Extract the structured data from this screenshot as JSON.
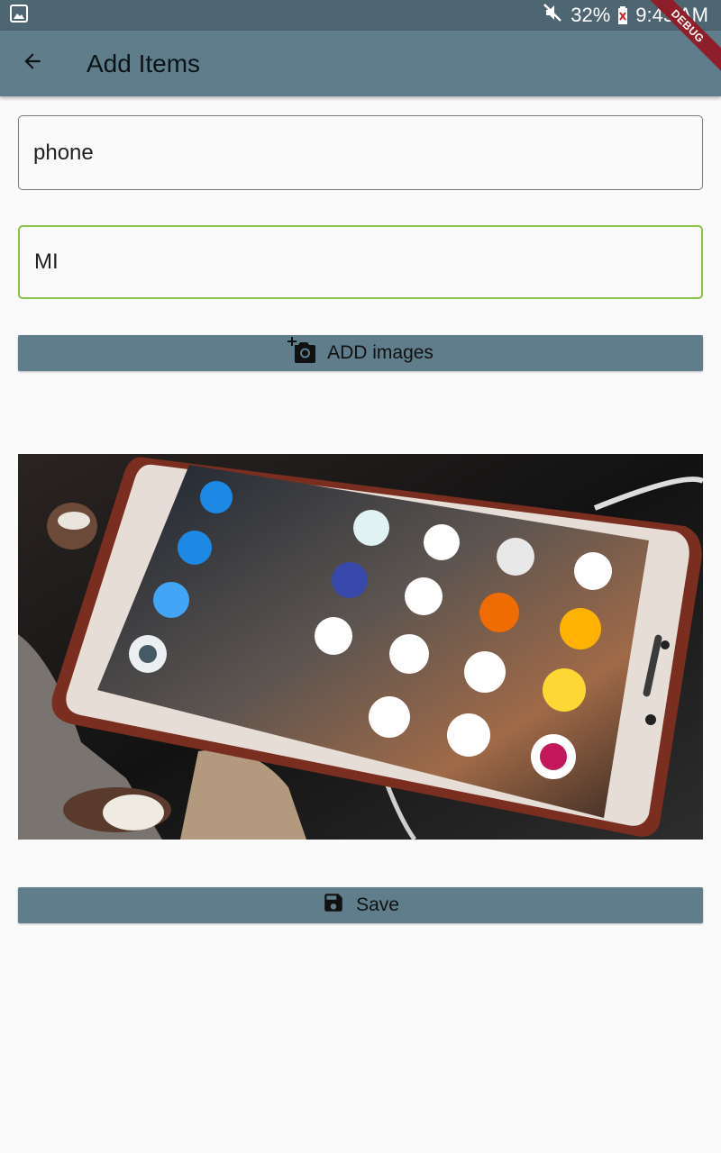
{
  "status_bar": {
    "battery": "32%",
    "time": "9:45 AM",
    "icons": [
      "gallery-icon",
      "mute-icon",
      "battery-icon"
    ]
  },
  "app_bar": {
    "title": "Add Items",
    "back_icon": "arrow-back-icon"
  },
  "debug_banner": "DEBUG",
  "form": {
    "name_value": "phone",
    "brand_value": "MI",
    "add_images_label": "ADD images",
    "add_images_icon": "add-a-photo-icon",
    "save_label": "Save",
    "save_icon": "save-icon"
  },
  "colors": {
    "app_bar": "#607d8b",
    "status_bar": "#4e6572",
    "focused_border": "#8bc34a",
    "debug_banner": "#8e1f2a"
  }
}
